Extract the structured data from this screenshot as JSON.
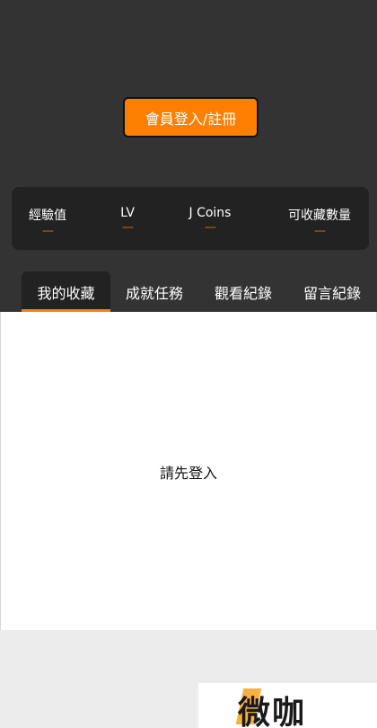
{
  "header": {
    "login_button_label": "會員登入/註冊"
  },
  "stats": [
    {
      "label": "經驗值",
      "value": "----"
    },
    {
      "label": "LV",
      "value": "----"
    },
    {
      "label": "J Coins",
      "value": "----"
    },
    {
      "label": "可收藏數量",
      "value": "----"
    }
  ],
  "tabs": [
    {
      "label": "我的收藏",
      "active": true
    },
    {
      "label": "成就任務",
      "active": false
    },
    {
      "label": "觀看紀錄",
      "active": false
    },
    {
      "label": "留言紀錄",
      "active": false
    }
  ],
  "content": {
    "empty_message": "請先登入"
  },
  "watermark": {
    "text": "微咖"
  },
  "colors": {
    "accent": "#ff7f00",
    "header_bg": "#333333",
    "panel_bg": "#222222"
  }
}
